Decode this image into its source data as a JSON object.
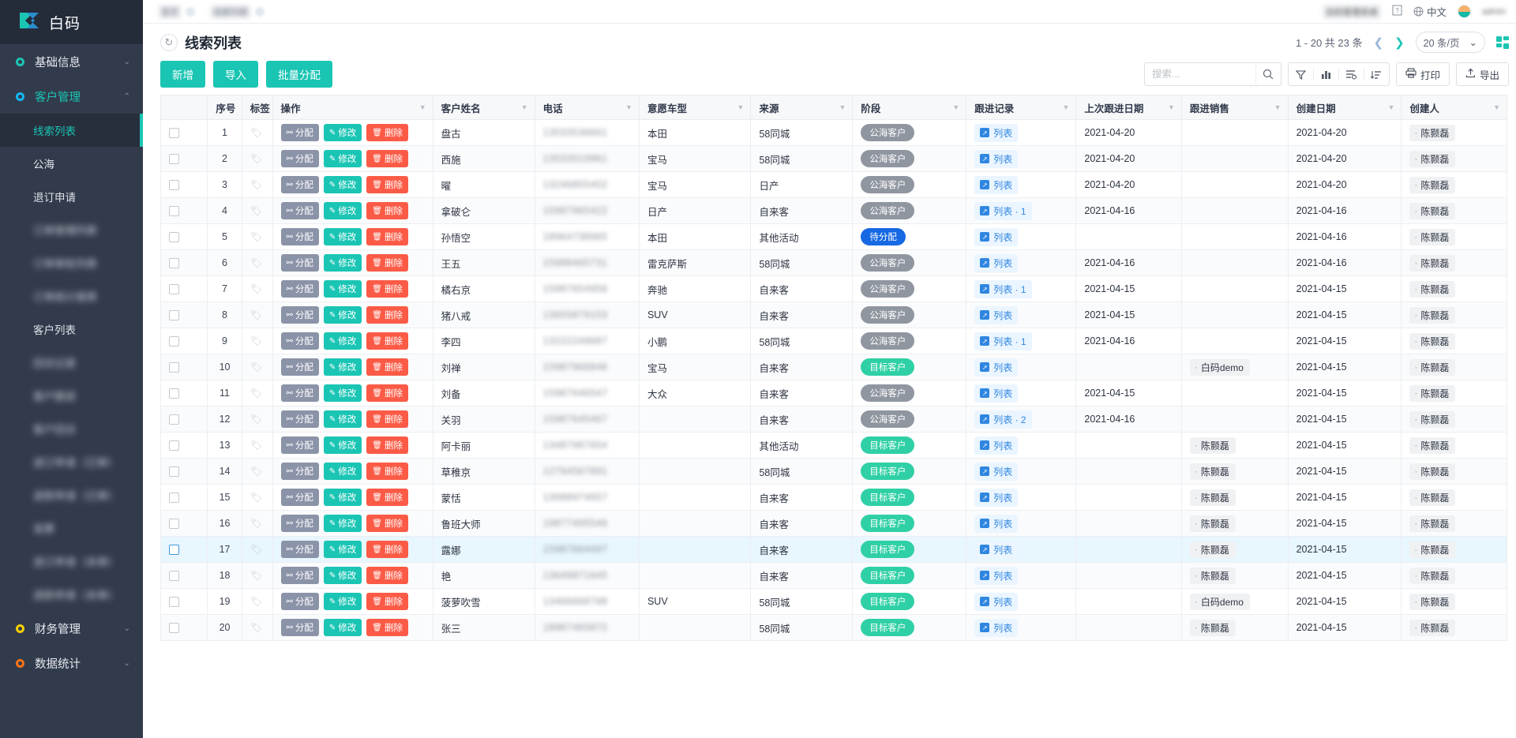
{
  "brand": {
    "name": "白码"
  },
  "sidebar": {
    "groups": [
      {
        "label": "基础信息",
        "dot": "teal",
        "chevron": "⌄",
        "active": false,
        "items": []
      },
      {
        "label": "客户管理",
        "dot": "blue",
        "chevron": "⌃",
        "active": true,
        "items": [
          {
            "label": "线索列表",
            "active": true,
            "blurred": false
          },
          {
            "label": "公海",
            "active": false,
            "blurred": false
          },
          {
            "label": "退订申请",
            "active": false,
            "blurred": false
          },
          {
            "label": "订单管理列表",
            "active": false,
            "blurred": true
          },
          {
            "label": "订单审批列表",
            "active": false,
            "blurred": true
          },
          {
            "label": "订单统计报表",
            "active": false,
            "blurred": true
          },
          {
            "label": "客户列表",
            "active": false,
            "blurred": false
          },
          {
            "label": "回访记录",
            "active": false,
            "blurred": true
          },
          {
            "label": "客户跟进",
            "active": false,
            "blurred": true
          },
          {
            "label": "客户回访",
            "active": false,
            "blurred": true
          },
          {
            "label": "退订申请（已审）",
            "active": false,
            "blurred": true
          },
          {
            "label": "退款申请（已审）",
            "active": false,
            "blurred": true
          },
          {
            "label": "发票",
            "active": false,
            "blurred": true
          },
          {
            "label": "退订申请（未审）",
            "active": false,
            "blurred": true
          },
          {
            "label": "退款申请（未审）",
            "active": false,
            "blurred": true
          }
        ]
      },
      {
        "label": "财务管理",
        "dot": "yellow",
        "chevron": "⌄",
        "active": false,
        "items": []
      },
      {
        "label": "数据统计",
        "dot": "orange",
        "chevron": "⌄",
        "active": false,
        "items": []
      }
    ]
  },
  "topbar": {
    "tabs": [
      {
        "label": "首页",
        "close": "×"
      },
      {
        "label": "线索列表",
        "close": "×"
      }
    ],
    "right": {
      "workspace": "白码管理系统",
      "help_icon": "?",
      "globe_icon": "🌐",
      "lang": "中文",
      "avatar": "avatar",
      "user": "admin"
    }
  },
  "page": {
    "refresh_icon": "↻",
    "title": "线索列表",
    "pagination": {
      "range": "1 - 20  共 23 条",
      "prev": "❮",
      "next": "❯",
      "page_size": "20 条/页",
      "caret": "⌄"
    },
    "buttons": [
      {
        "label": "新增"
      },
      {
        "label": "导入"
      },
      {
        "label": "批量分配"
      }
    ],
    "search": {
      "placeholder": "搜索...",
      "value": "",
      "icon": "search-icon"
    },
    "tools": {
      "filter_icon": "▽",
      "chart_icon": "▮▯▮",
      "group_icon": "≡",
      "sort_icon": "↕",
      "print_label": "打印",
      "print_icon": "🖨",
      "export_label": "导出",
      "export_icon": "↥"
    }
  },
  "table": {
    "columns": [
      {
        "label": "序号",
        "caret": false
      },
      {
        "label": "标签",
        "caret": false
      },
      {
        "label": "操作",
        "caret": true
      },
      {
        "label": "客户姓名",
        "caret": true
      },
      {
        "label": "电话",
        "caret": true
      },
      {
        "label": "意愿车型",
        "caret": true
      },
      {
        "label": "来源",
        "caret": true
      },
      {
        "label": "阶段",
        "caret": true
      },
      {
        "label": "跟进记录",
        "caret": true
      },
      {
        "label": "上次跟进日期",
        "caret": true
      },
      {
        "label": "跟进销售",
        "caret": true
      },
      {
        "label": "创建日期",
        "caret": true
      },
      {
        "label": "创建人",
        "caret": true
      }
    ],
    "ops": [
      {
        "label": "分配",
        "icon": "share-icon",
        "glyph": "⚯"
      },
      {
        "label": "修改",
        "icon": "pencil-icon",
        "glyph": "✎"
      },
      {
        "label": "删除",
        "icon": "trash-icon",
        "glyph": "🗑"
      }
    ],
    "rows": [
      {
        "seq": "1",
        "name": "盘古",
        "phone": "13533536661",
        "car": "本田",
        "source": "58同城",
        "stage": "公海客户",
        "stage_color": "gray",
        "follow": "列表",
        "last": "2021-04-20",
        "sales": "",
        "created": "2021-04-20",
        "creator": "陈颢磊",
        "selected": false,
        "alt": false
      },
      {
        "seq": "2",
        "name": "西施",
        "phone": "13533519961",
        "car": "宝马",
        "source": "58同城",
        "stage": "公海客户",
        "stage_color": "gray",
        "follow": "列表",
        "last": "2021-04-20",
        "sales": "",
        "created": "2021-04-20",
        "creator": "陈颢磊",
        "selected": false,
        "alt": true
      },
      {
        "seq": "3",
        "name": "曜",
        "phone": "13246855452",
        "car": "宝马",
        "source": "日产",
        "stage": "公海客户",
        "stage_color": "gray",
        "follow": "列表",
        "last": "2021-04-20",
        "sales": "",
        "created": "2021-04-20",
        "creator": "陈颢磊",
        "selected": false,
        "alt": false
      },
      {
        "seq": "4",
        "name": "拿破仑",
        "phone": "15987965422",
        "car": "日产",
        "source": "自来客",
        "stage": "公海客户",
        "stage_color": "gray",
        "follow": "列表 · 1",
        "last": "2021-04-16",
        "sales": "",
        "created": "2021-04-16",
        "creator": "陈颢磊",
        "selected": false,
        "alt": true
      },
      {
        "seq": "5",
        "name": "孙悟空",
        "phone": "18964738965",
        "car": "本田",
        "source": "其他活动",
        "stage": "待分配",
        "stage_color": "blue",
        "follow": "列表",
        "last": "",
        "sales": "",
        "created": "2021-04-16",
        "creator": "陈颢磊",
        "selected": false,
        "alt": false
      },
      {
        "seq": "6",
        "name": "王五",
        "phone": "15988465731",
        "car": "雷克萨斯",
        "source": "58同城",
        "stage": "公海客户",
        "stage_color": "gray",
        "follow": "列表",
        "last": "2021-04-16",
        "sales": "",
        "created": "2021-04-16",
        "creator": "陈颢磊",
        "selected": false,
        "alt": true
      },
      {
        "seq": "7",
        "name": "橘右京",
        "phone": "15987654956",
        "car": "奔驰",
        "source": "自来客",
        "stage": "公海客户",
        "stage_color": "gray",
        "follow": "列表 · 1",
        "last": "2021-04-15",
        "sales": "",
        "created": "2021-04-15",
        "creator": "陈颢磊",
        "selected": false,
        "alt": false
      },
      {
        "seq": "8",
        "name": "猪八戒",
        "phone": "13655879153",
        "car": "SUV",
        "source": "自来客",
        "stage": "公海客户",
        "stage_color": "gray",
        "follow": "列表",
        "last": "2021-04-15",
        "sales": "",
        "created": "2021-04-15",
        "creator": "陈颢磊",
        "selected": false,
        "alt": true
      },
      {
        "seq": "9",
        "name": "李四",
        "phone": "13222249687",
        "car": "小鹏",
        "source": "58同城",
        "stage": "公海客户",
        "stage_color": "gray",
        "follow": "列表 · 1",
        "last": "2021-04-16",
        "sales": "",
        "created": "2021-04-15",
        "creator": "陈颢磊",
        "selected": false,
        "alt": false
      },
      {
        "seq": "10",
        "name": "刘禅",
        "phone": "15987966846",
        "car": "宝马",
        "source": "自来客",
        "stage": "目标客户",
        "stage_color": "green",
        "follow": "列表",
        "last": "",
        "sales": "白码demo",
        "created": "2021-04-15",
        "creator": "陈颢磊",
        "selected": false,
        "alt": true
      },
      {
        "seq": "11",
        "name": "刘备",
        "phone": "15987646547",
        "car": "大众",
        "source": "自来客",
        "stage": "公海客户",
        "stage_color": "gray",
        "follow": "列表",
        "last": "2021-04-15",
        "sales": "",
        "created": "2021-04-15",
        "creator": "陈颢磊",
        "selected": false,
        "alt": false
      },
      {
        "seq": "12",
        "name": "关羽",
        "phone": "15987645467",
        "car": "",
        "source": "自来客",
        "stage": "公海客户",
        "stage_color": "gray",
        "follow": "列表 · 2",
        "last": "2021-04-16",
        "sales": "",
        "created": "2021-04-15",
        "creator": "陈颢磊",
        "selected": false,
        "alt": true
      },
      {
        "seq": "13",
        "name": "阿卡丽",
        "phone": "13487987654",
        "car": "",
        "source": "其他活动",
        "stage": "目标客户",
        "stage_color": "green",
        "follow": "列表",
        "last": "",
        "sales": "陈颢磊",
        "created": "2021-04-15",
        "creator": "陈颢磊",
        "selected": false,
        "alt": false
      },
      {
        "seq": "14",
        "name": "草稚京",
        "phone": "12794567891",
        "car": "",
        "source": "58同城",
        "stage": "目标客户",
        "stage_color": "green",
        "follow": "列表",
        "last": "",
        "sales": "陈颢磊",
        "created": "2021-04-15",
        "creator": "陈颢磊",
        "selected": false,
        "alt": true
      },
      {
        "seq": "15",
        "name": "蒙恬",
        "phone": "13688974657",
        "car": "",
        "source": "自来客",
        "stage": "目标客户",
        "stage_color": "green",
        "follow": "列表",
        "last": "",
        "sales": "陈颢磊",
        "created": "2021-04-15",
        "creator": "陈颢磊",
        "selected": false,
        "alt": false
      },
      {
        "seq": "16",
        "name": "鲁班大师",
        "phone": "19877495546",
        "car": "",
        "source": "自来客",
        "stage": "目标客户",
        "stage_color": "green",
        "follow": "列表",
        "last": "",
        "sales": "陈颢磊",
        "created": "2021-04-15",
        "creator": "陈颢磊",
        "selected": false,
        "alt": true
      },
      {
        "seq": "17",
        "name": "露娜",
        "phone": "15987664497",
        "car": "",
        "source": "自来客",
        "stage": "目标客户",
        "stage_color": "green",
        "follow": "列表",
        "last": "",
        "sales": "陈颢磊",
        "created": "2021-04-15",
        "creator": "陈颢磊",
        "selected": true,
        "alt": false
      },
      {
        "seq": "18",
        "name": "艳",
        "phone": "13649871645",
        "car": "",
        "source": "自来客",
        "stage": "目标客户",
        "stage_color": "green",
        "follow": "列表",
        "last": "",
        "sales": "陈颢磊",
        "created": "2021-04-15",
        "creator": "陈颢磊",
        "selected": false,
        "alt": true
      },
      {
        "seq": "19",
        "name": "菠萝吹雪",
        "phone": "13466668798",
        "car": "SUV",
        "source": "58同城",
        "stage": "目标客户",
        "stage_color": "green",
        "follow": "列表",
        "last": "",
        "sales": "白码demo",
        "created": "2021-04-15",
        "creator": "陈颢磊",
        "selected": false,
        "alt": false
      },
      {
        "seq": "20",
        "name": "张三",
        "phone": "18987465872",
        "car": "",
        "source": "58同城",
        "stage": "目标客户",
        "stage_color": "green",
        "follow": "列表",
        "last": "",
        "sales": "陈颢磊",
        "created": "2021-04-15",
        "creator": "陈颢磊",
        "selected": false,
        "alt": true
      }
    ]
  },
  "colors": {
    "accent": "#1bc5b4",
    "sidebar_bg": "#323b4c",
    "danger": "#fb5b46",
    "assign": "#8b93a8",
    "badge_blue": "#1668e3",
    "badge_green": "#2fd0a5",
    "badge_gray": "#9096a0"
  }
}
